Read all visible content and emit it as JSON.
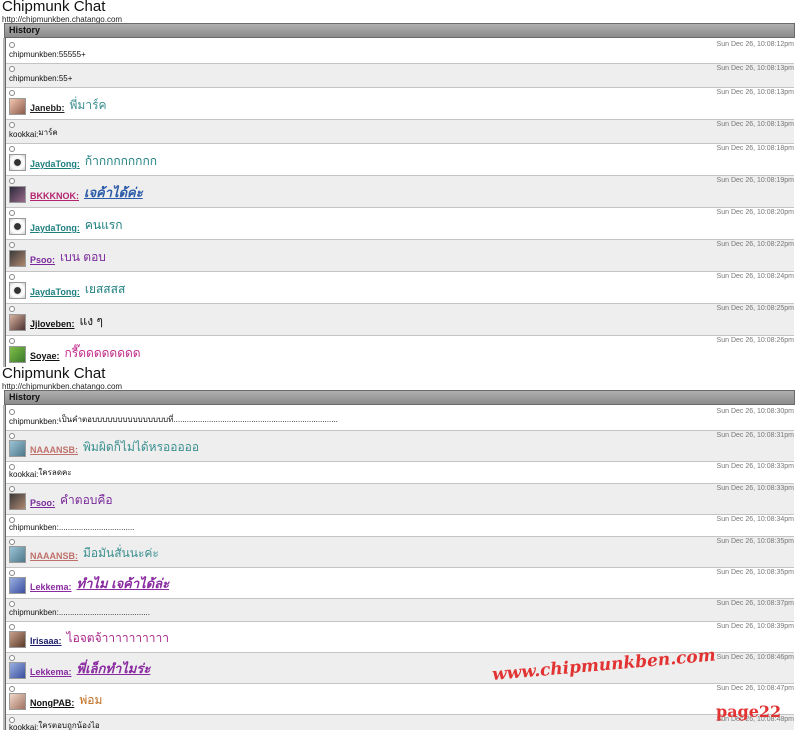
{
  "panels": [
    {
      "title": "Chipmunk Chat",
      "url": "http://chipmunkben.chatango.com",
      "history_label": "History",
      "messages": [
        {
          "h": 24,
          "shade": false,
          "type": "plain",
          "user": "chipmunkben",
          "text": "55555+",
          "time": "Sun Dec 26, 10:08:12pm"
        },
        {
          "h": 24,
          "shade": true,
          "type": "plain",
          "user": "chipmunkben",
          "text": "55+",
          "time": "Sun Dec 26, 10:08:13pm"
        },
        {
          "h": 32,
          "shade": false,
          "type": "user",
          "avatar": "a-jane",
          "name_color": "#222222",
          "text_color": "#3b8f8f",
          "user": "Janebb:",
          "text": "พี่มาร์ค",
          "time": "Sun Dec 26, 10:08:13pm"
        },
        {
          "h": 24,
          "shade": true,
          "type": "plain",
          "user": "kookkai",
          "text": "มาร์ค",
          "time": "Sun Dec 26, 10:08:13pm"
        },
        {
          "h": 32,
          "shade": false,
          "type": "user",
          "avatar": "a-jayda",
          "name_color": "#1e7f7f",
          "text_color": "#1e7f7f",
          "user": "JaydaTong:",
          "text": "ก้ากกกกกกกก",
          "time": "Sun Dec 26, 10:08:18pm"
        },
        {
          "h": 32,
          "shade": true,
          "type": "user",
          "avatar": "a-bkkk",
          "name_color": "#b4246e",
          "text_color": "#2a5aa8",
          "user": "BKKKNOK:",
          "text": "เจค้าได้ค่ะ",
          "style": "ital",
          "time": "Sun Dec 26, 10:08:19pm"
        },
        {
          "h": 32,
          "shade": false,
          "type": "user",
          "avatar": "a-jayda",
          "name_color": "#1e7f7f",
          "text_color": "#1e7f7f",
          "user": "JaydaTong:",
          "text": "คนแรก",
          "time": "Sun Dec 26, 10:08:20pm"
        },
        {
          "h": 32,
          "shade": true,
          "type": "user",
          "avatar": "a-psoo",
          "name_color": "#7a2a9a",
          "text_color": "#7a2a9a",
          "user": "Psoo:",
          "text": "เบน ตอบ",
          "time": "Sun Dec 26, 10:08:22pm"
        },
        {
          "h": 32,
          "shade": false,
          "type": "user",
          "avatar": "a-jayda",
          "name_color": "#1e7f7f",
          "text_color": "#1e7f7f",
          "user": "JaydaTong:",
          "text": "เยสสสส",
          "time": "Sun Dec 26, 10:08:24pm"
        },
        {
          "h": 32,
          "shade": true,
          "type": "user",
          "avatar": "a-jjl",
          "name_color": "#111111",
          "text_color": "#111111",
          "user": "Jjloveben:",
          "text": "แง ๆ",
          "time": "Sun Dec 26, 10:08:25pm"
        },
        {
          "h": 32,
          "shade": false,
          "type": "user",
          "avatar": "a-soyae",
          "name_color": "#111111",
          "text_color": "#c02a8a",
          "user": "Soyae:",
          "text": "กรี๊ดดดดดดดด",
          "time": "Sun Dec 26, 10:08:26pm"
        }
      ]
    },
    {
      "title": "Chipmunk Chat",
      "url": "http://chipmunkben.chatango.com",
      "history_label": "History",
      "messages": [
        {
          "h": 24,
          "shade": false,
          "type": "plain",
          "user": "chipmunkben",
          "text": "เป็นคำตอบบบบบบบบบบบบบบบที่..........................................................................",
          "time": "Sun Dec 26, 10:08:30pm"
        },
        {
          "h": 31,
          "shade": true,
          "type": "user",
          "avatar": "a-naaa",
          "name_color": "#c0706a",
          "text_color": "#3b8f8f",
          "user": "NAAANSB:",
          "text": "พิมผิดก็ไม่ได้หรอออออ",
          "time": "Sun Dec 26, 10:08:31pm"
        },
        {
          "h": 22,
          "shade": false,
          "type": "plain",
          "user": "kookkai",
          "text": "ใครลดคะ",
          "time": "Sun Dec 26, 10:08:33pm"
        },
        {
          "h": 31,
          "shade": true,
          "type": "user",
          "avatar": "a-psoo",
          "name_color": "#7a2a9a",
          "text_color": "#7a2a9a",
          "user": "Psoo:",
          "text": "คำตอบคือ",
          "time": "Sun Dec 26, 10:08:33pm"
        },
        {
          "h": 22,
          "shade": false,
          "type": "plain",
          "user": "chipmunkben",
          "text": "..................................",
          "time": "Sun Dec 26, 10:08:34pm"
        },
        {
          "h": 31,
          "shade": true,
          "type": "user",
          "avatar": "a-naaa",
          "name_color": "#c0706a",
          "text_color": "#3b8f8f",
          "user": "NAAANSB:",
          "text": "มือมันสั่นนะค่ะ",
          "time": "Sun Dec 26, 10:08:35pm"
        },
        {
          "h": 31,
          "shade": false,
          "type": "user",
          "avatar": "a-lek",
          "name_color": "#8a2aa0",
          "text_color": "#8a2aa0",
          "user": "Lekkema:",
          "text": "ทำไม เจค้าได้ล่ะ",
          "style": "ital",
          "time": "Sun Dec 26, 10:08:35pm"
        },
        {
          "h": 23,
          "shade": true,
          "type": "plain",
          "user": "chipmunkben",
          "text": ".........................................",
          "time": "Sun Dec 26, 10:08:37pm"
        },
        {
          "h": 31,
          "shade": false,
          "type": "user",
          "avatar": "a-iri",
          "name_color": "#1a1a6a",
          "text_color": "#a8248a",
          "user": "Irisaaa:",
          "text": "ไอจตจ้าาาาาาาาาา",
          "time": "Sun Dec 26, 10:08:39pm"
        },
        {
          "h": 31,
          "shade": true,
          "type": "user",
          "avatar": "a-lek",
          "name_color": "#8a2aa0",
          "text_color": "#8a2aa0",
          "user": "Lekkema:",
          "text": "พี่เล็กทำไมร่ะ",
          "style": "ital",
          "time": "Sun Dec 26, 10:08:46pm"
        },
        {
          "h": 31,
          "shade": false,
          "type": "user",
          "avatar": "a-nong",
          "name_color": "#111111",
          "text_color": "#c06a1a",
          "user": "NongPAB:",
          "text": "พ่อม",
          "time": "Sun Dec 26, 10:08:47pm"
        },
        {
          "h": 22,
          "shade": true,
          "type": "plain",
          "user": "kookkai",
          "text": "ใครตอบถูกน้องไอ",
          "time": "Sun Dec 26, 10:08:48pm"
        }
      ]
    }
  ],
  "watermark": "www.chipmunkben.com",
  "page_label": "page22",
  "colors": {
    "watermark": "#e23232",
    "history_bar": "#9c9c9c"
  }
}
